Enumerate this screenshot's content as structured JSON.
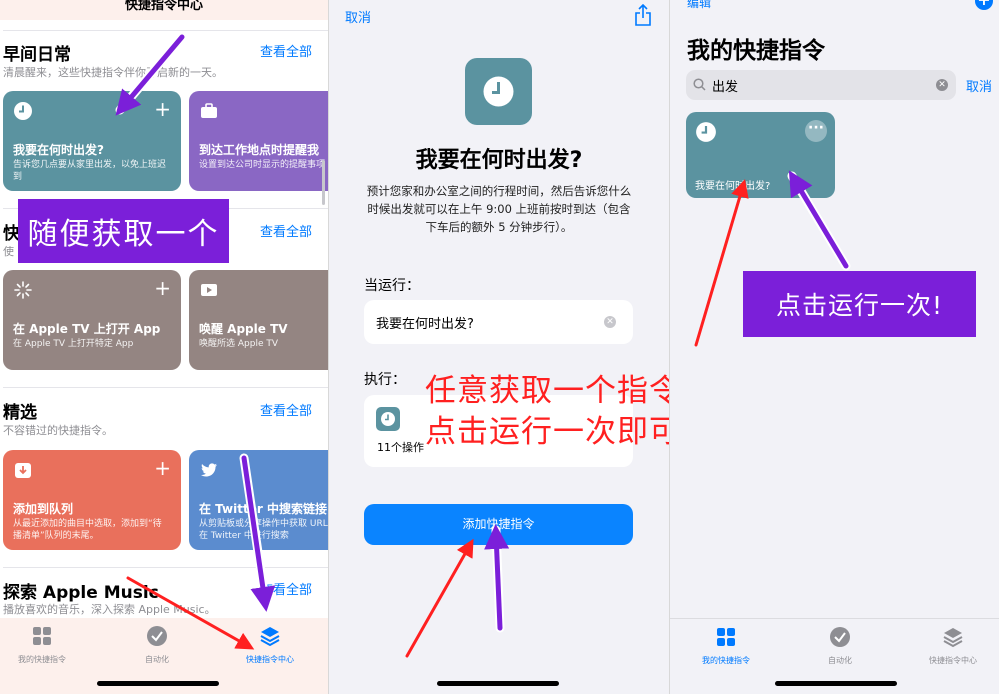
{
  "panel1": {
    "header_title": "快捷指令中心",
    "sections": [
      {
        "title": "早间日常",
        "subtitle": "清晨醒来，这些快捷指令伴你开启新的一天。",
        "see_all": "查看全部"
      },
      {
        "title": "快",
        "subtitle": "使",
        "see_all": "查看全部"
      },
      {
        "title": "精选",
        "subtitle": "不容错过的快捷指令。",
        "see_all": "查看全部"
      },
      {
        "title": "探索 Apple Music",
        "subtitle": "播放喜欢的音乐，深入探索 Apple Music。",
        "see_all": "查看全部"
      }
    ],
    "cards": [
      {
        "icon": "clock-icon",
        "title": "我要在何时出发?",
        "desc": "告诉您几点要从家里出发，以免上班迟到",
        "color": "#5b93a0"
      },
      {
        "icon": "briefcase-icon",
        "title": "到达工作地点时提醒我",
        "desc": "设置到达公司时显示的提醒事项",
        "color": "#8a67c4"
      },
      {
        "icon": "sparkle-icon",
        "title": "在 Apple TV 上打开 App",
        "desc": "在 Apple TV 上打开特定 App",
        "color": "#948582"
      },
      {
        "icon": "tv-play-icon",
        "title": "唤醒 Apple TV",
        "desc": "唤醒所选 Apple TV",
        "color": "#948582"
      },
      {
        "icon": "download-icon",
        "title": "添加到队列",
        "desc": "从最近添加的曲目中选取，添加到“待播清单”队列的末尾。",
        "color": "#e9705c"
      },
      {
        "icon": "twitter-icon",
        "title": "在 Twitter 中搜索链接",
        "desc": "从剪贴板或分享操作中获取 URL，然后在 Twitter 中进行搜索",
        "color": "#5b8ccf"
      }
    ],
    "annotation": "随便获取一个",
    "tabs": [
      {
        "label": "我的快捷指令",
        "icon": "grid-icon"
      },
      {
        "label": "自动化",
        "icon": "clock-check-icon"
      },
      {
        "label": "快捷指令中心",
        "icon": "layers-icon"
      }
    ]
  },
  "panel2": {
    "cancel": "取消",
    "title": "我要在何时出发?",
    "description": "预计您家和办公室之间的行程时间，然后告诉您什么时候出发就可以在上午 9:00 上班前按时到达（包含下车后的额外 5 分钟步行）。",
    "when_run_label": "当运行：",
    "when_run_value": "我要在何时出发?",
    "execute_label": "执行：",
    "steps": "11个操作",
    "add_button": "添加快捷指令",
    "overlay_line1": "任意获取一个指令",
    "overlay_line2": "点击运行一次即可"
  },
  "panel3": {
    "edit": "编辑",
    "title": "我的快捷指令",
    "search_value": "出发",
    "cancel": "取消",
    "card_label": "我要在何时出发?",
    "annotation": "点击运行一次!",
    "tabs": [
      {
        "label": "我的快捷指令",
        "icon": "grid-icon"
      },
      {
        "label": "自动化",
        "icon": "clock-check-icon"
      },
      {
        "label": "快捷指令中心",
        "icon": "layers-icon"
      }
    ]
  },
  "colors": {
    "accent_blue": "#007aff",
    "annotation_purple": "#7b1fd9",
    "annotation_red": "#ff2020"
  }
}
